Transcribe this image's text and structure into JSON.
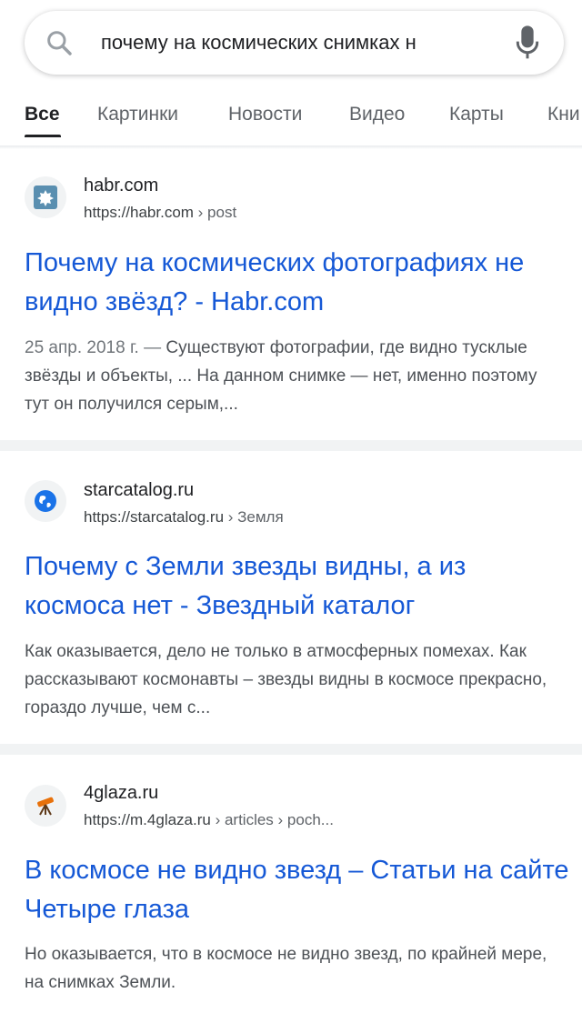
{
  "search": {
    "query": "почему на космических снимках н"
  },
  "tabs": [
    {
      "label": "Все",
      "active": true
    },
    {
      "label": "Картинки",
      "active": false
    },
    {
      "label": "Новости",
      "active": false
    },
    {
      "label": "Видео",
      "active": false
    },
    {
      "label": "Карты",
      "active": false
    },
    {
      "label": "Кни",
      "active": false
    }
  ],
  "results": [
    {
      "site_name": "habr.com",
      "url_base": "https://habr.com",
      "url_crumbs": " › post",
      "title": "Почему на космических фотографиях не видно звёзд? - Habr.com",
      "date": "25 апр. 2018 г. — ",
      "snippet": "Существуют фотографии, где видно тусклые звёзды и объекты, ... На данном снимке — нет, именно поэтому тут он получился серым,...",
      "favicon": "habr-icon",
      "favicon_color": "#5a8fb0"
    },
    {
      "site_name": "starcatalog.ru",
      "url_base": "https://starcatalog.ru",
      "url_crumbs": " › Земля",
      "title": "Почему с Земли звезды видны, а из космоса нет - Звездный каталог",
      "date": "",
      "snippet": "Как оказывается, дело не только в атмосферных помехах. Как рассказывают космонавты – звезды видны в космосе прекрасно, гораздо лучше, чем с...",
      "favicon": "globe-icon",
      "favicon_color": "#1a73e8"
    },
    {
      "site_name": "4glaza.ru",
      "url_base": "https://m.4glaza.ru",
      "url_crumbs": " › articles › poch...",
      "title": "В космосе не видно звезд – Статьи на сайте Четыре глаза",
      "date": "",
      "snippet": "Но оказывается, что в космосе не видно звезд, по крайней мере, на снимках Земли.",
      "favicon": "telescope-icon",
      "favicon_color": "#e8710a"
    }
  ]
}
